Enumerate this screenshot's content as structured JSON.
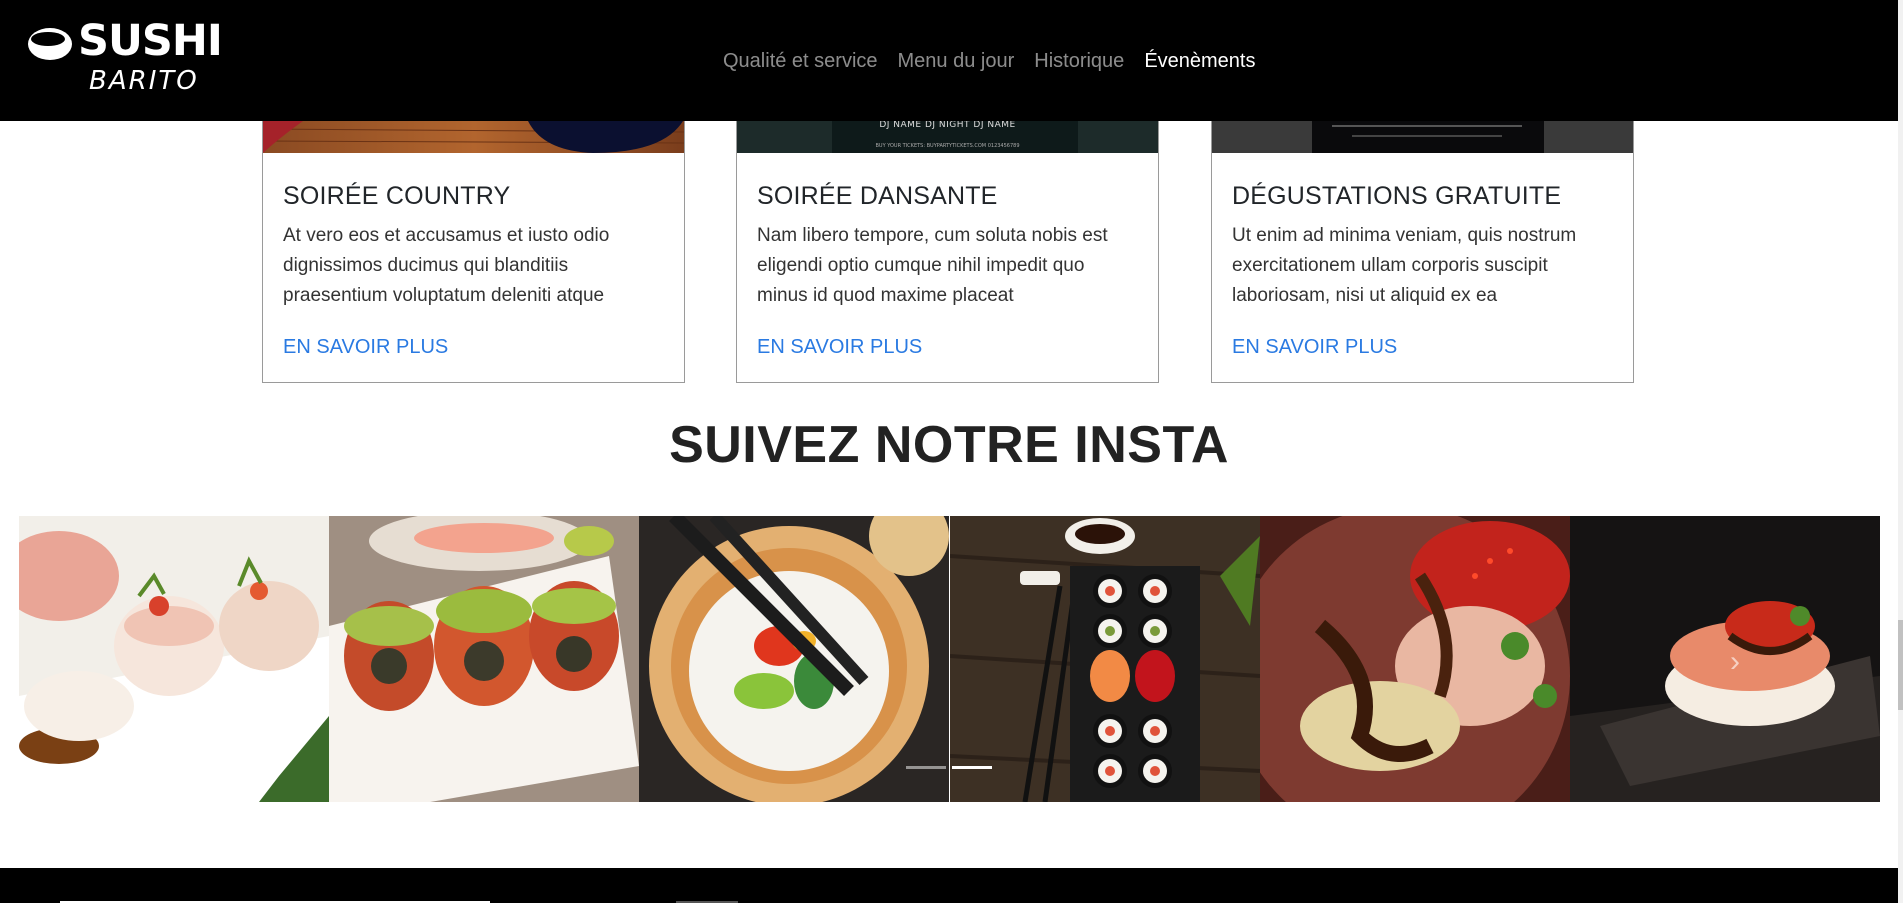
{
  "brand": {
    "name": "SUSHI",
    "sub": "BARITO"
  },
  "nav": {
    "items": [
      {
        "label": "Qualité et service",
        "active": false
      },
      {
        "label": "Menu du jour",
        "active": false
      },
      {
        "label": "Historique",
        "active": false
      },
      {
        "label": "Évenèments",
        "active": true
      }
    ]
  },
  "events": [
    {
      "title": "SOIRÉE COUNTRY",
      "text": "At vero eos et accusamus et iusto odio dignissimos ducimus qui blanditiis praesentium voluptatum deleniti atque",
      "link": "EN SAVOIR PLUS"
    },
    {
      "title": "SOIRÉE DANSANTE",
      "text": "Nam libero tempore, cum soluta nobis est eligendi optio cumque nihil impedit quo minus id quod maxime placeat",
      "link": "EN SAVOIR PLUS",
      "poster_lines": [
        "DJ NAME   DJ NIGHT   DJ NAME",
        "BUY YOUR TICKETS: BUYPARTYTICKETS.COM 0123456789"
      ]
    },
    {
      "title": "DÉGUSTATIONS GRATUITE",
      "text": "Ut enim ad minima veniam, quis nostrum exercitationem ullam corporis suscipit laboriosam, nisi ut aliquid ex ea",
      "link": "EN SAVOIR PLUS"
    }
  ],
  "insta": {
    "title": "SUIVEZ NOTRE INSTA",
    "photos": [
      "sushi-nigiri-plate",
      "dragon-roll-avocado",
      "futomaki-chopsticks",
      "maki-platter-board",
      "sashimi-eel-sauce",
      "nigiri-tobiko-slate"
    ],
    "indicators": [
      false,
      true
    ]
  },
  "colors": {
    "nav_bg": "#000000",
    "link": "#2a7ae2",
    "text": "#212529"
  }
}
